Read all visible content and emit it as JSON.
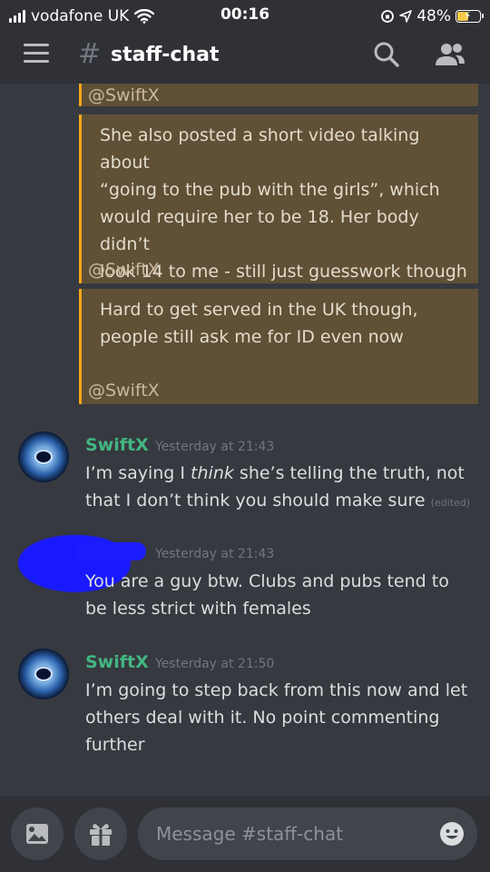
{
  "status_bar": {
    "carrier": "vodafone UK",
    "time": "00:16",
    "battery": "48%"
  },
  "header": {
    "channel_hash": "#",
    "channel_name": "staff-chat"
  },
  "quotes": [
    {
      "mention": "@SwiftX",
      "lines": []
    },
    {
      "mention": "@SwiftX",
      "lines": [
        "She also posted a short video talking about",
        "“going to the pub with the girls”, which",
        "would require her to be 18. Her body didn’t",
        "look 14 to me - still just guesswork though"
      ]
    },
    {
      "mention": "@SwiftX",
      "lines": [
        "Hard to get served in the UK though,",
        "people still ask me for ID even now"
      ]
    }
  ],
  "messages": [
    {
      "author": "SwiftX",
      "author_color": "#43b581",
      "timestamp": "Yesterday at 21:43",
      "line1_pre": "I’m saying I ",
      "line1_em": "think",
      "line1_post": " she’s telling the truth, not",
      "line2": "that I don’t think you should make sure",
      "edited": "(edited)"
    },
    {
      "author": "",
      "timestamp": "Yesterday at 21:43",
      "lines": [
        "You are a guy btw. Clubs and pubs tend to",
        "be less strict with females"
      ]
    },
    {
      "author": "SwiftX",
      "author_color": "#43b581",
      "timestamp": "Yesterday at 21:50",
      "lines": [
        "I’m going to step back from this now and let",
        "others deal with it. No point commenting",
        "further"
      ]
    }
  ],
  "composer": {
    "placeholder": "Message #staff-chat"
  },
  "icons": {
    "menu": "hamburger-icon",
    "search": "search-icon",
    "members": "members-icon",
    "image": "image-icon",
    "gift": "gift-icon",
    "emoji": "emoji-icon"
  },
  "colors": {
    "background": "#36393f",
    "bars": "#2f3136",
    "quote_bg": "#5f5036",
    "quote_border": "#faa61a",
    "accent_name": "#43b581",
    "redaction": "#1c1cff"
  }
}
